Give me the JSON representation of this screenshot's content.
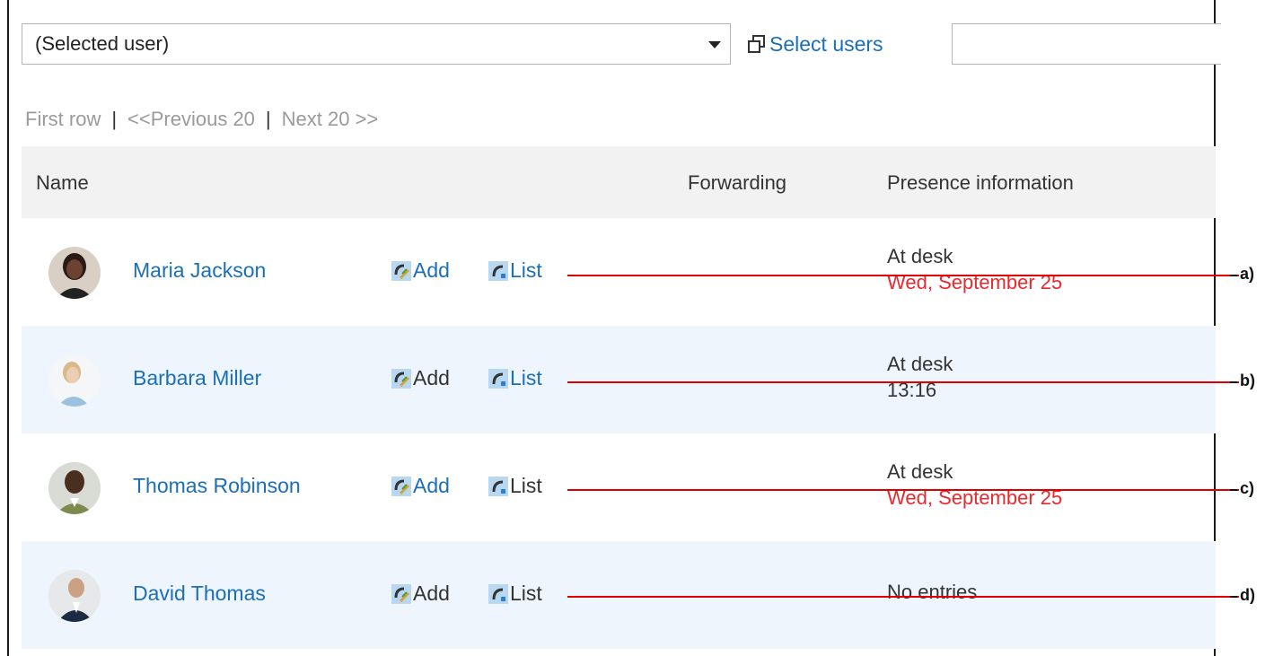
{
  "toolbar": {
    "select_value": "(Selected user)",
    "select_users_label": "Select users",
    "search_placeholder": ""
  },
  "pager": {
    "first": "First row",
    "previous": "<<Previous 20",
    "next": "Next 20 >>",
    "separator": "|"
  },
  "table": {
    "headers": {
      "name": "Name",
      "forwarding": "Forwarding",
      "presence": "Presence information"
    },
    "rows": [
      {
        "name": "Maria Jackson",
        "add": "Add",
        "list": "List",
        "list_is_link": true,
        "presence_status": "At desk",
        "presence_time": "Wed, September 25",
        "time_highlight": true
      },
      {
        "name": "Barbara Miller",
        "add": "Add",
        "list": "List",
        "list_is_link": true,
        "presence_status": "At desk",
        "presence_time": "13:16",
        "time_highlight": false
      },
      {
        "name": "Thomas Robinson",
        "add": "Add",
        "list": "List",
        "list_is_link": false,
        "presence_status": "At desk",
        "presence_time": "Wed, September 25",
        "time_highlight": true
      },
      {
        "name": "David Thomas",
        "add": "Add",
        "list": "List",
        "list_is_link": false,
        "presence_status": "No entries",
        "presence_time": "",
        "time_highlight": false
      }
    ]
  },
  "callouts": [
    "a)",
    "b)",
    "c)",
    "d)"
  ],
  "colors": {
    "link": "#1b6fb8",
    "highlight_date": "#e8292e",
    "callout_line": "#e00000",
    "row_alt": "#eef5fc",
    "header_bg": "#f2f2f2"
  },
  "icons": {
    "add": "phone-add-icon",
    "list": "phone-list-icon",
    "select_users": "select-users-icon",
    "dropdown": "chevron-down-icon"
  }
}
